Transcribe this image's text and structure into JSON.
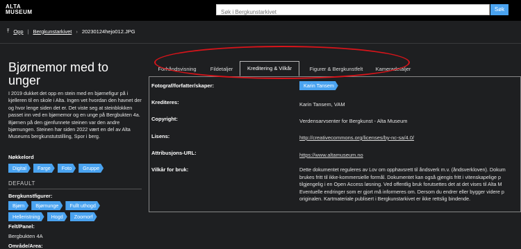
{
  "header": {
    "logo_line1": "ALTA",
    "logo_line2": "MUSEUM",
    "search_placeholder": "Søk i Bergkunstarkivet",
    "search_button": "Søk"
  },
  "breadcrumb": {
    "up": "Opp",
    "archive": "Bergkunstarkivet",
    "current": "20230124hejo012.JPG"
  },
  "left": {
    "title": "Bjørnemor med to unger",
    "description": "I 2019 dukket det opp en stein med en bjørnefigur på i kjelleren til en skole i Alta. Ingen vet hvordan den havnet der og hvor lenge siden det er. Det viste seg at steinblokken passet inn ved en bjørnemor og en unge på Bergbukten 4a. Bjørnen på den gjenfunnete steinen var den andre bjørnungen. Steinen har siden 2022 vært en del av  Alta Museums bergkunstutstilling, Spor i berg.",
    "keywords_label": "Nøkkelord",
    "keywords": [
      "Digital",
      "Farge",
      "Foto",
      "Gruppe"
    ],
    "section_title": "DEFAULT",
    "figures_label": "Bergkunstfigurer:",
    "figures": [
      "Bjørn",
      "Bjørnunge",
      "Fullt uthogd",
      "Helleristning",
      "Hogd",
      "Zoomorf"
    ],
    "field_label": "Felt/Panel:",
    "field_value": "Bergbukten 4A",
    "area_label": "Område/Area:"
  },
  "tabs": [
    "Forhåndsvisning",
    "Fildetaljer",
    "Kreditering & Vilkår",
    "Figurer & Bergkunstfelt",
    "Kameradetaljer"
  ],
  "credits": {
    "photographer_label": "Fotograf/forfatter/skaper:",
    "photographer_value": "Karin Tansem",
    "credits_label": "Krediteres:",
    "credits_value": "Karin Tansem, VAM",
    "copyright_label": "Copyright:",
    "copyright_value": "Verdensarvsenter for Bergkunst - Alta Museum",
    "license_label": "Lisens:",
    "license_value": "http://creativecommons.org/licenses/by-nc-sa/4.0/",
    "url_label": "Attribusjons-URL:",
    "url_value": "https://www.altamuseum.no",
    "terms_label": "Vilkår for bruk:",
    "terms_lines": [
      "Dette dokumentet reguleres av Lov om opphavsrett til åndsverk m.v. (åndsverkloven). Dokum",
      "brukes fritt til ikke-kommersielle formål. Dokumentet kan også gjengis fritt i vitenskapelige p",
      "tilgjengelig i en Open Access løsning. Ved offentlig bruk forutsettes det at det vises til Alta M",
      "Eventuelle endringer som er gjort må informeres om. Dersom du endrer eller bygger videre p",
      "originalen. Kartmateriale publisert i Bergkunstarkivet er ikke rettslig bindende."
    ]
  },
  "colors": {
    "accent": "#4aa3f0",
    "highlight": "#d9141a",
    "background": "#1e1f21"
  }
}
